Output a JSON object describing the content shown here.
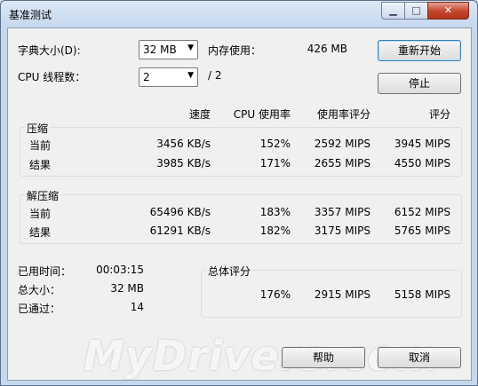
{
  "window": {
    "title": "基准测试",
    "close_glyph": "✕",
    "min_glyph": "▁",
    "max_glyph": "□"
  },
  "settings": {
    "dict_label": "字典大小(D):",
    "dict_value": "32 MB",
    "mem_label": "内存使用：",
    "mem_value": "426 MB",
    "threads_label": "CPU 线程数：",
    "threads_value": "2",
    "threads_total": "/ 2"
  },
  "buttons": {
    "restart": "重新开始",
    "stop": "停止",
    "help": "帮助",
    "cancel": "取消"
  },
  "columns": {
    "speed": "速度",
    "cpu": "CPU 使用率",
    "rating": "使用率评分",
    "score": "评分"
  },
  "compress": {
    "title": "压缩",
    "rows": [
      {
        "label": "当前",
        "speed": "3456 KB/s",
        "cpu": "152%",
        "rating": "2592 MIPS",
        "score": "3945 MIPS"
      },
      {
        "label": "结果",
        "speed": "3985 KB/s",
        "cpu": "171%",
        "rating": "2655 MIPS",
        "score": "4550 MIPS"
      }
    ]
  },
  "decompress": {
    "title": "解压缩",
    "rows": [
      {
        "label": "当前",
        "speed": "65496 KB/s",
        "cpu": "183%",
        "rating": "3357 MIPS",
        "score": "6152 MIPS"
      },
      {
        "label": "结果",
        "speed": "61291 KB/s",
        "cpu": "182%",
        "rating": "3175 MIPS",
        "score": "5765 MIPS"
      }
    ]
  },
  "stats": {
    "elapsed_label": "已用时间：",
    "elapsed_value": "00:03:15",
    "size_label": "总大小：",
    "size_value": "32 MB",
    "passes_label": "已通过：",
    "passes_value": "14"
  },
  "total": {
    "title": "总体评分",
    "cpu": "176%",
    "rating": "2915 MIPS",
    "score": "5158 MIPS"
  },
  "watermark": "MyDrivers.com"
}
